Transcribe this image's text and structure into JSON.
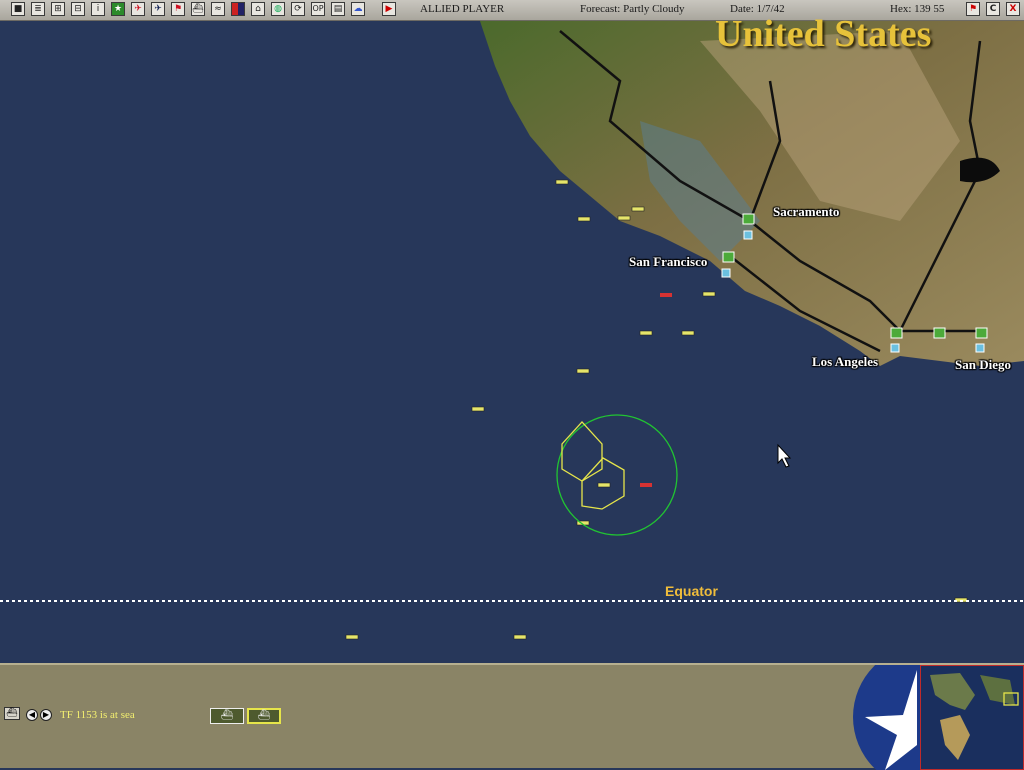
{
  "toolbar": {
    "player": "ALLIED PLAYER",
    "forecast": "Forecast: Partly Cloudy",
    "date": "Date: 1/7/42",
    "hex": "Hex: 139 55",
    "right_buttons": [
      "flag-icon",
      "C",
      "X"
    ],
    "icons": [
      "save-icon",
      "document-icon",
      "group-icon",
      "overview-icon",
      "info-icon",
      "star-icon",
      "aircraft-icon",
      "aircraft-icon-blue",
      "flag-icon",
      "ship-icon",
      "route-icon",
      "color-icon",
      "ship-list-icon",
      "globe-icon",
      "refresh-icon",
      "op-icon",
      "report-icon",
      "cloud-icon",
      "end-turn-icon"
    ],
    "op_label": "OP"
  },
  "map": {
    "region_label": "United States",
    "cities": [
      "Sacramento",
      "San Francisco",
      "Los Angeles",
      "San Diego"
    ],
    "equator_label": "Equator",
    "colors": {
      "ocean": "#27375a",
      "land": "#6b6b45",
      "label": "#e7c23a",
      "selection": "#21c432",
      "hex": "#e6e54a",
      "enemy": "#d73232"
    }
  },
  "bottom": {
    "status_text": "TF 1153 is at sea"
  }
}
